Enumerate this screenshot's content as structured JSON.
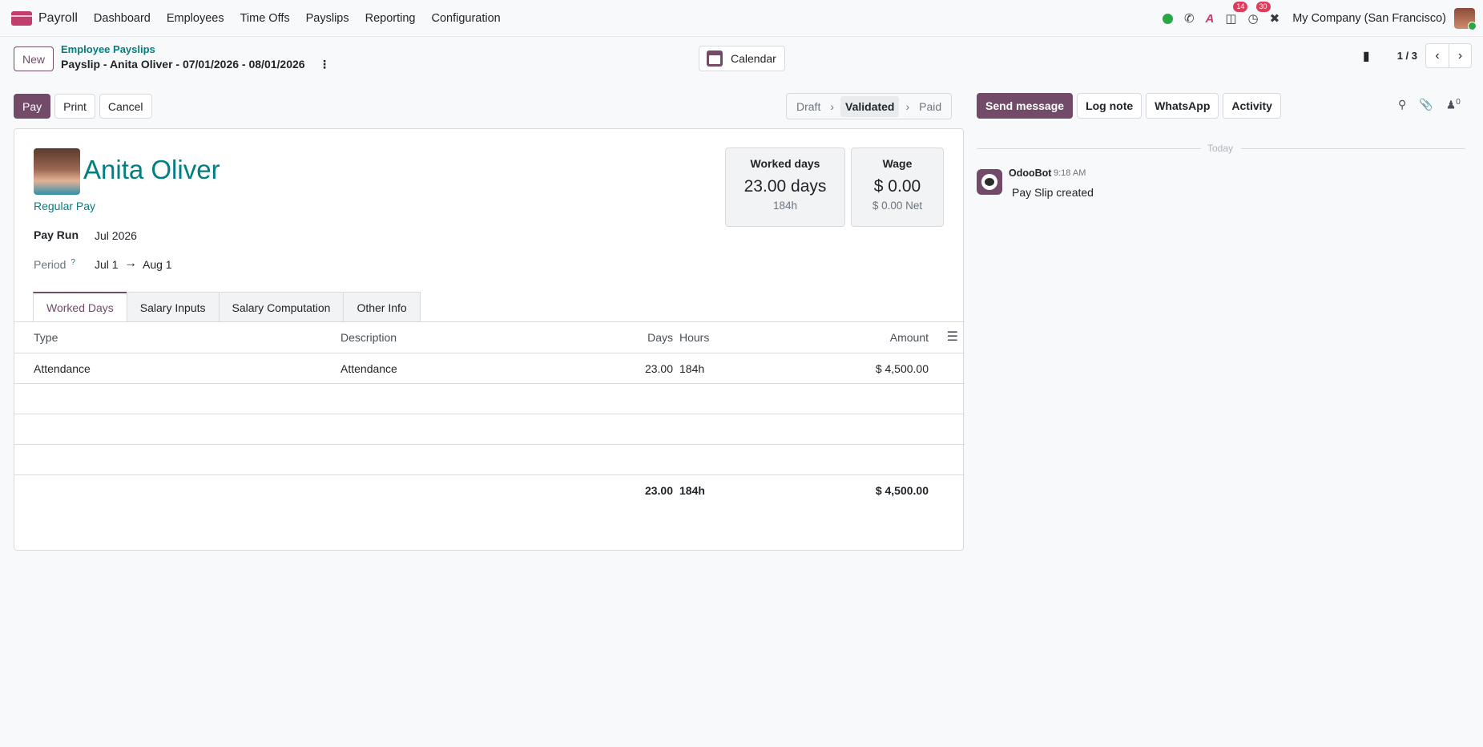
{
  "navbar": {
    "app_name": "Payroll",
    "menu": [
      "Dashboard",
      "Employees",
      "Time Offs",
      "Payslips",
      "Reporting",
      "Configuration"
    ],
    "messages_badge": "14",
    "activities_badge": "30",
    "company": "My Company (San Francisco)"
  },
  "control_panel": {
    "new_label": "New",
    "breadcrumb_parent": "Employee Payslips",
    "breadcrumb_current": "Payslip - Anita Oliver - 07/01/2026 - 08/01/2026",
    "calendar_label": "Calendar",
    "pager": "1 / 3"
  },
  "actions": {
    "pay": "Pay",
    "print": "Print",
    "cancel": "Cancel"
  },
  "statusbar": {
    "stages": [
      "Draft",
      "Validated",
      "Paid"
    ],
    "current": "Validated"
  },
  "employee": {
    "name": "Anita Oliver",
    "structure_type": "Regular Pay",
    "pay_run_label": "Pay Run",
    "pay_run": "Jul 2026",
    "period_label": "Period",
    "period_help": "?",
    "period_start": "Jul 1",
    "period_end": "Aug 1"
  },
  "stats": {
    "worked_days": {
      "title": "Worked days",
      "main": "23.00 days",
      "sub": "184h"
    },
    "wage": {
      "title": "Wage",
      "main": "$ 0.00",
      "sub": "$ 0.00 Net"
    }
  },
  "tabs": [
    "Worked Days",
    "Salary Inputs",
    "Salary Computation",
    "Other Info"
  ],
  "worked_days_table": {
    "headers": {
      "type": "Type",
      "description": "Description",
      "days": "Days",
      "hours": "Hours",
      "amount": "Amount"
    },
    "rows": [
      {
        "type": "Attendance",
        "description": "Attendance",
        "days": "23.00",
        "hours": "184h",
        "amount": "$ 4,500.00"
      }
    ],
    "totals": {
      "days": "23.00",
      "hours": "184h",
      "amount": "$ 4,500.00"
    }
  },
  "chatter": {
    "send_message": "Send message",
    "log_note": "Log note",
    "whatsapp": "WhatsApp",
    "activity": "Activity",
    "followers_count": "0",
    "date_separator": "Today",
    "message": {
      "author": "OdooBot",
      "time": "9:18 AM",
      "body": "Pay Slip created"
    }
  }
}
